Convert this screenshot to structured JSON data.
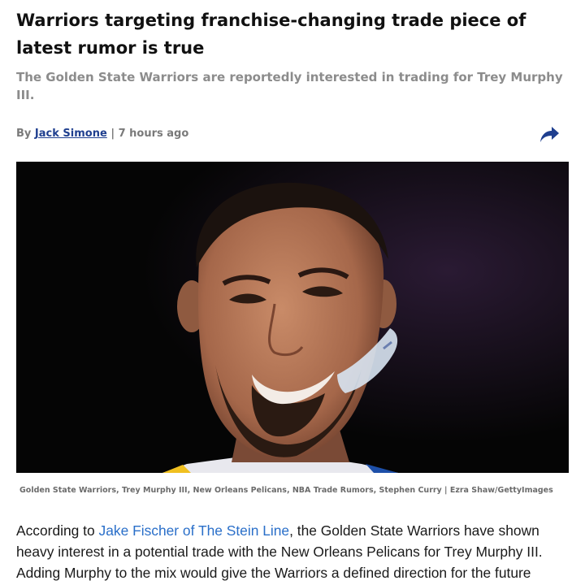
{
  "article": {
    "headline": "Warriors targeting franchise-changing trade piece of latest rumor is true",
    "subheadline": "The Golden State Warriors are reportedly interested in trading for Trey Murphy III.",
    "byline": {
      "prefix": "By",
      "author": "Jack Simone",
      "separator": "|",
      "time": "7 hours ago"
    },
    "share_icon": "share-arrow-icon",
    "image": {
      "caption": "Golden State Warriors, Trey Murphy III, New Orleans Pelicans, NBA Trade Rumors, Stephen Curry | Ezra Shaw/GettyImages"
    },
    "body": {
      "intro": "According to",
      "link_text": "Jake Fischer of The Stein Line",
      "rest": ", the Golden State Warriors have shown heavy interest in a potential trade with the New Orleans Pelicans for Trey Murphy III. Adding Murphy to the mix would give the Warriors a defined direction for the future"
    }
  },
  "colors": {
    "headline": "#111111",
    "subheadline": "#8c8c8c",
    "byline": "#7a7a7a",
    "author_link": "#1f3f8f",
    "share_icon": "#1f3f8f",
    "body_link": "#2a6fc9"
  }
}
